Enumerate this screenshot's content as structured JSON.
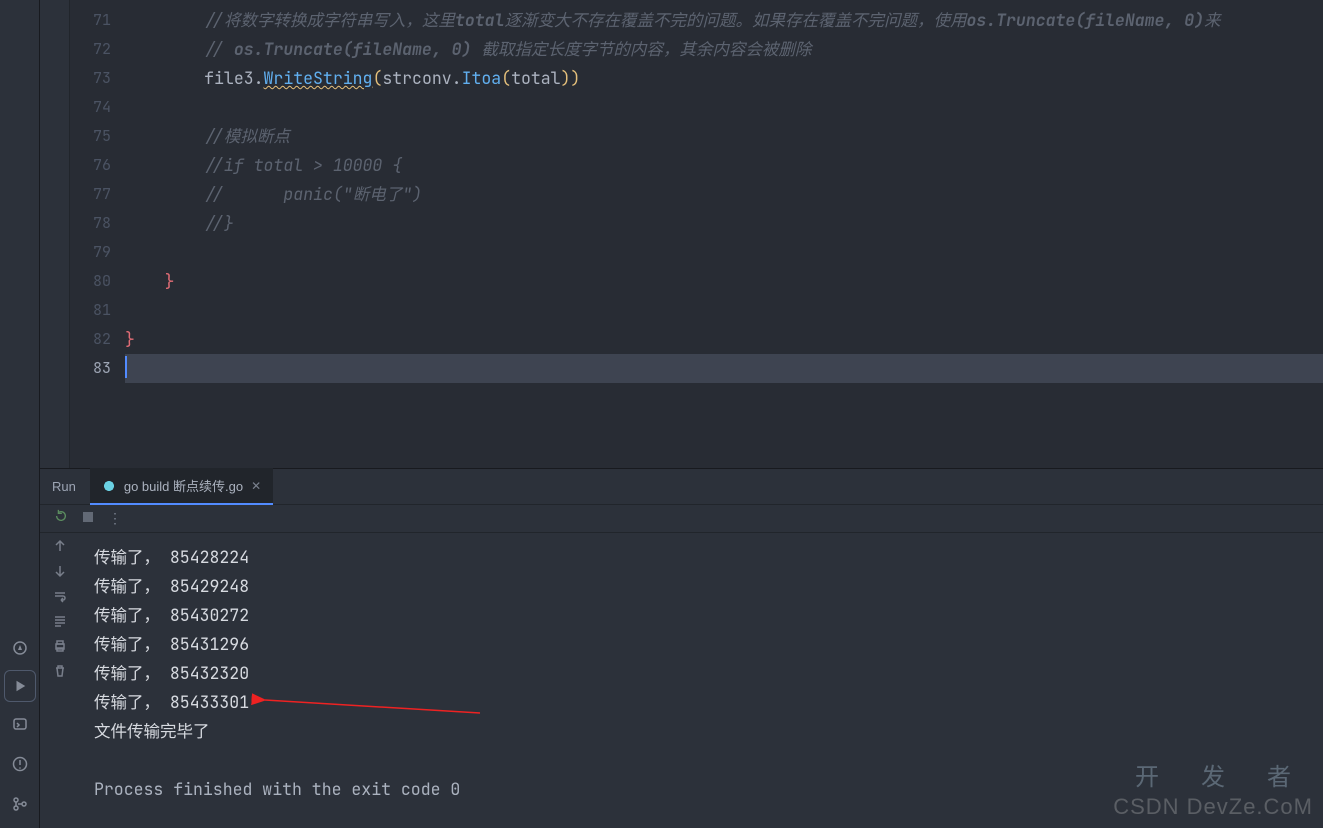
{
  "editor": {
    "first_line_no": 71,
    "last_line_no": 83,
    "current_line": 83,
    "lines": {
      "71": {
        "indent": 2,
        "tokens": [
          {
            "t": "//将数字转换成字符串写入，这里",
            "cls": "cm"
          },
          {
            "t": "total",
            "cls": "cm",
            "bold": true
          },
          {
            "t": "逐渐变大不存在覆盖不完的问题。如果存在覆盖不完问题，使用",
            "cls": "cm"
          },
          {
            "t": "os.Truncate(fileName, 0)",
            "cls": "cm",
            "bold": true
          },
          {
            "t": "来",
            "cls": "cm"
          }
        ]
      },
      "72": {
        "indent": 2,
        "tokens": [
          {
            "t": "// ",
            "cls": "cm"
          },
          {
            "t": "os.Truncate(fileName, 0)",
            "cls": "cm",
            "bold": true
          },
          {
            "t": " 截取指定长度字节的内容，其余内容会被删除",
            "cls": "cm"
          }
        ]
      },
      "73": {
        "indent": 2,
        "tokens": [
          {
            "t": "file3",
            "cls": "id"
          },
          {
            "t": ".",
            "cls": "op"
          },
          {
            "t": "WriteString",
            "cls": "fn",
            "warn": true
          },
          {
            "t": "(",
            "cls": "paren"
          },
          {
            "t": "strconv",
            "cls": "id"
          },
          {
            "t": ".",
            "cls": "op"
          },
          {
            "t": "Itoa",
            "cls": "fn"
          },
          {
            "t": "(",
            "cls": "paren"
          },
          {
            "t": "total",
            "cls": "id"
          },
          {
            "t": "))",
            "cls": "paren"
          }
        ]
      },
      "74": {
        "indent": 2,
        "tokens": []
      },
      "75": {
        "indent": 2,
        "tokens": [
          {
            "t": "//模拟断点",
            "cls": "cm"
          }
        ]
      },
      "76": {
        "indent": 2,
        "tokens": [
          {
            "t": "//if total > 10000 {",
            "cls": "cm"
          }
        ]
      },
      "77": {
        "indent": 2,
        "tokens": [
          {
            "t": "//\tpanic(\"断电了\")",
            "cls": "cm"
          }
        ]
      },
      "78": {
        "indent": 2,
        "tokens": [
          {
            "t": "//}",
            "cls": "cm"
          }
        ]
      },
      "79": {
        "indent": 2,
        "tokens": []
      },
      "80": {
        "indent": 1,
        "tokens": [
          {
            "t": "}",
            "cls": "brace"
          }
        ]
      },
      "81": {
        "indent": 0,
        "tokens": []
      },
      "82": {
        "indent": 0,
        "tokens": [
          {
            "t": "}",
            "cls": "brace"
          }
        ]
      },
      "83": {
        "indent": 0,
        "tokens": []
      }
    }
  },
  "run": {
    "title": "Run",
    "tab_label": "go build 断点续传.go",
    "output": [
      "传输了， 85428224",
      "传输了， 85429248",
      "传输了， 85430272",
      "传输了， 85431296",
      "传输了， 85432320",
      "传输了， 85433301",
      "文件传输完毕了",
      "",
      "Process finished with the exit code 0"
    ]
  },
  "watermark": {
    "w1": "开 发 者",
    "w2": "CSDN DevZe.CoM",
    "w3": ""
  }
}
